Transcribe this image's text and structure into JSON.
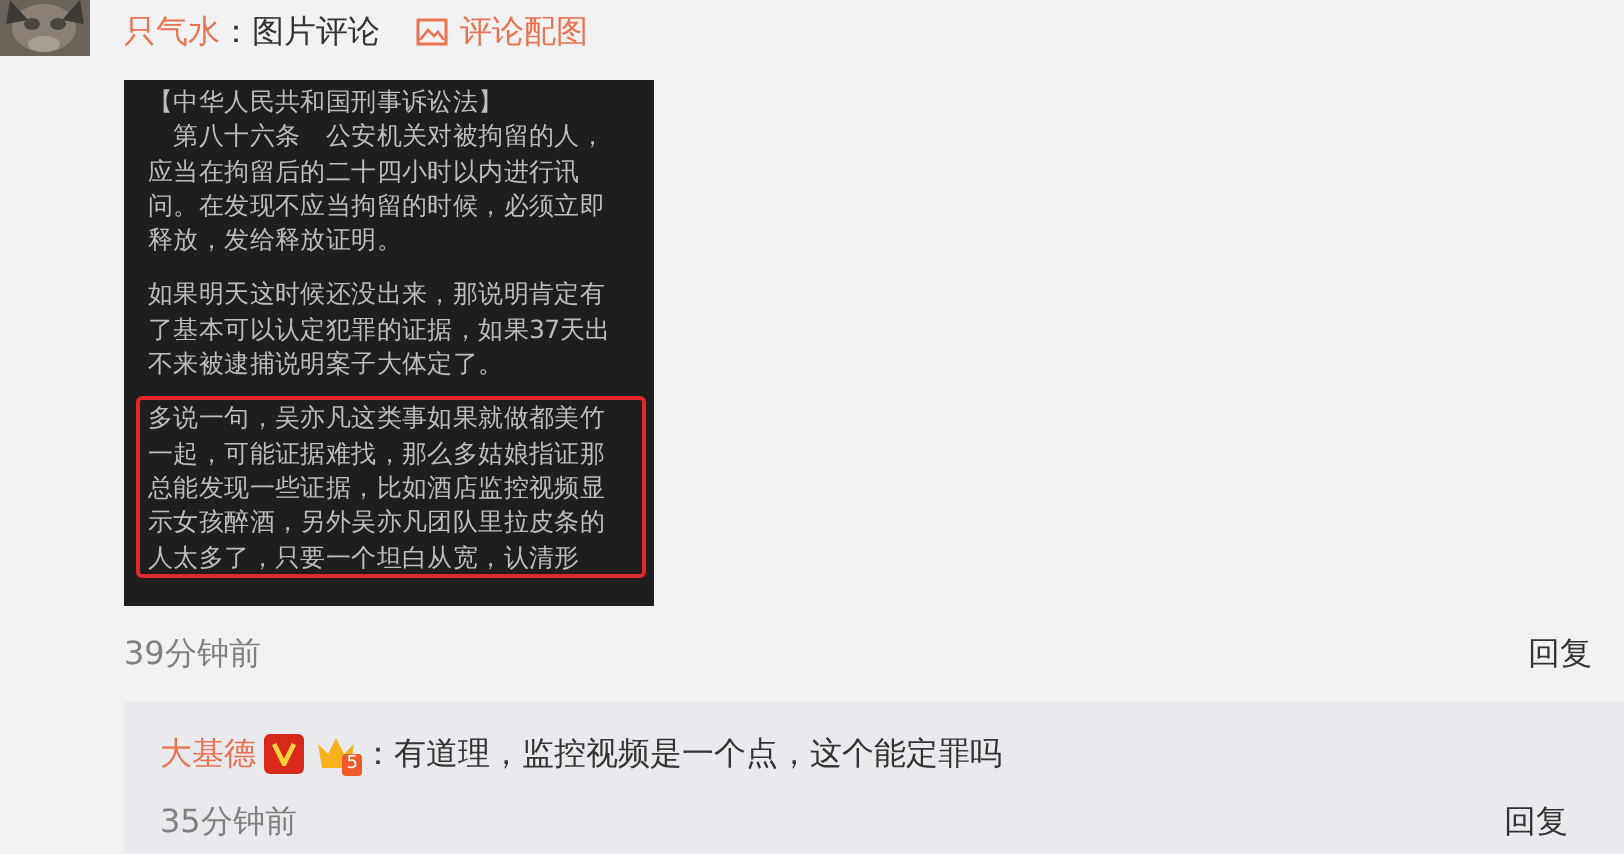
{
  "comment": {
    "user": "只气水",
    "separator": "：",
    "text": "图片评论",
    "image_link": "评论配图",
    "image": {
      "paragraphs": [
        {
          "highlighted": false,
          "lines": [
            "【中华人民共和国刑事诉讼法】",
            "　第八十六条　公安机关对被拘留的人，",
            "应当在拘留后的二十四小时以内进行讯",
            "问。在发现不应当拘留的时候，必须立即",
            "释放，发给释放证明。"
          ]
        },
        {
          "highlighted": false,
          "lines": [
            "如果明天这时候还没出来，那说明肯定有",
            "了基本可以认定犯罪的证据，如果37天出",
            "不来被逮捕说明案子大体定了。"
          ]
        },
        {
          "highlighted": true,
          "lines": [
            "多说一句，吴亦凡这类事如果就做都美竹",
            "一起，可能证据难找，那么多姑娘指证那",
            "总能发现一些证据，比如酒店监控视频显",
            "示女孩醉酒，另外吴亦凡团队里拉皮条的",
            "人太多了，只要一个坦白从宽，认清形"
          ]
        }
      ]
    },
    "time": "39分钟前",
    "reply_label": "回复"
  },
  "replies": [
    {
      "user": "大基德",
      "verified": true,
      "level": "5",
      "separator": "：",
      "text": "有道理，监控视频是一个点，这个能定罪吗",
      "time": "35分钟前",
      "reply_label": "回复"
    }
  ]
}
